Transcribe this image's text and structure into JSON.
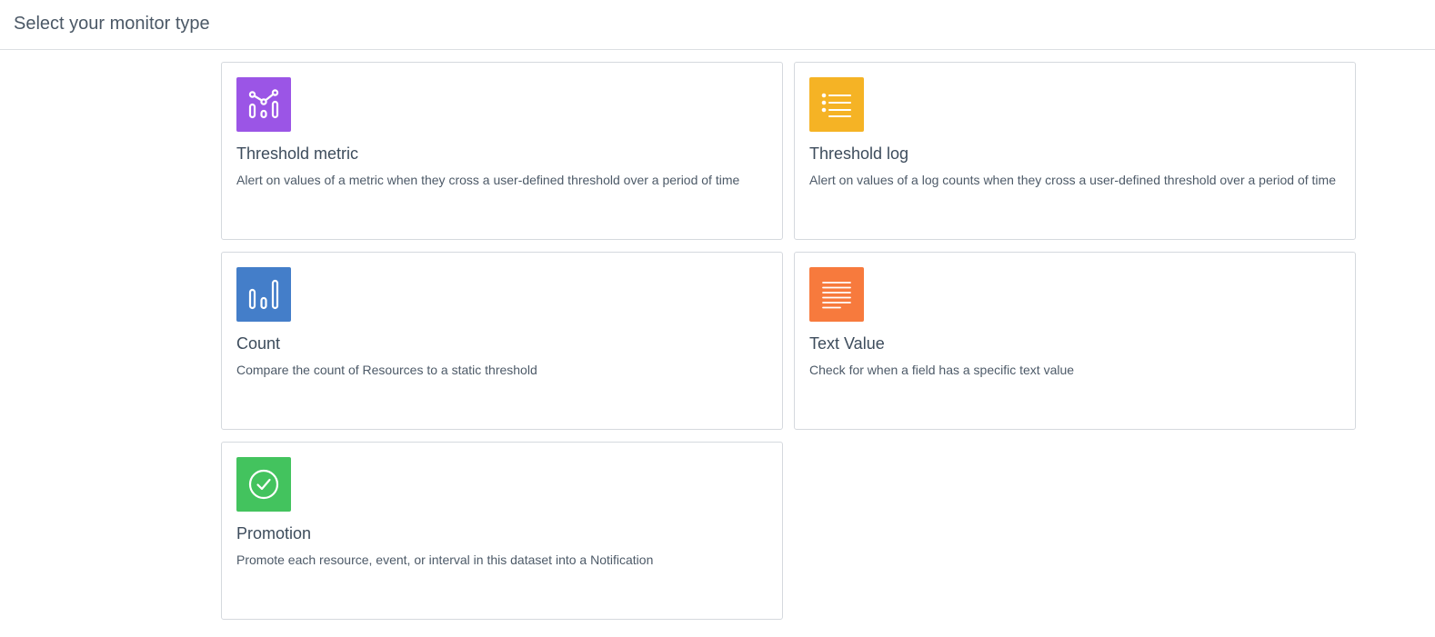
{
  "header": {
    "title": "Select your monitor type"
  },
  "cards": [
    {
      "key": "threshold-metric",
      "title": "Threshold metric",
      "description": "Alert on values of a metric when they cross a user-defined threshold over a period of time",
      "icon": "metric-chart-icon",
      "color": "#9b55e6"
    },
    {
      "key": "threshold-log",
      "title": "Threshold log",
      "description": "Alert on values of a log counts when they cross a user-defined threshold over a period of time",
      "icon": "list-icon",
      "color": "#f5b325"
    },
    {
      "key": "count",
      "title": "Count",
      "description": "Compare the count of Resources to a static threshold",
      "icon": "bar-chart-icon",
      "color": "#447ec9"
    },
    {
      "key": "text-value",
      "title": "Text Value",
      "description": "Check for when a field has a specific text value",
      "icon": "text-lines-icon",
      "color": "#f77a3d"
    },
    {
      "key": "promotion",
      "title": "Promotion",
      "description": "Promote each resource, event, or interval in this dataset into a Notification",
      "icon": "check-circle-icon",
      "color": "#43c35e"
    }
  ]
}
